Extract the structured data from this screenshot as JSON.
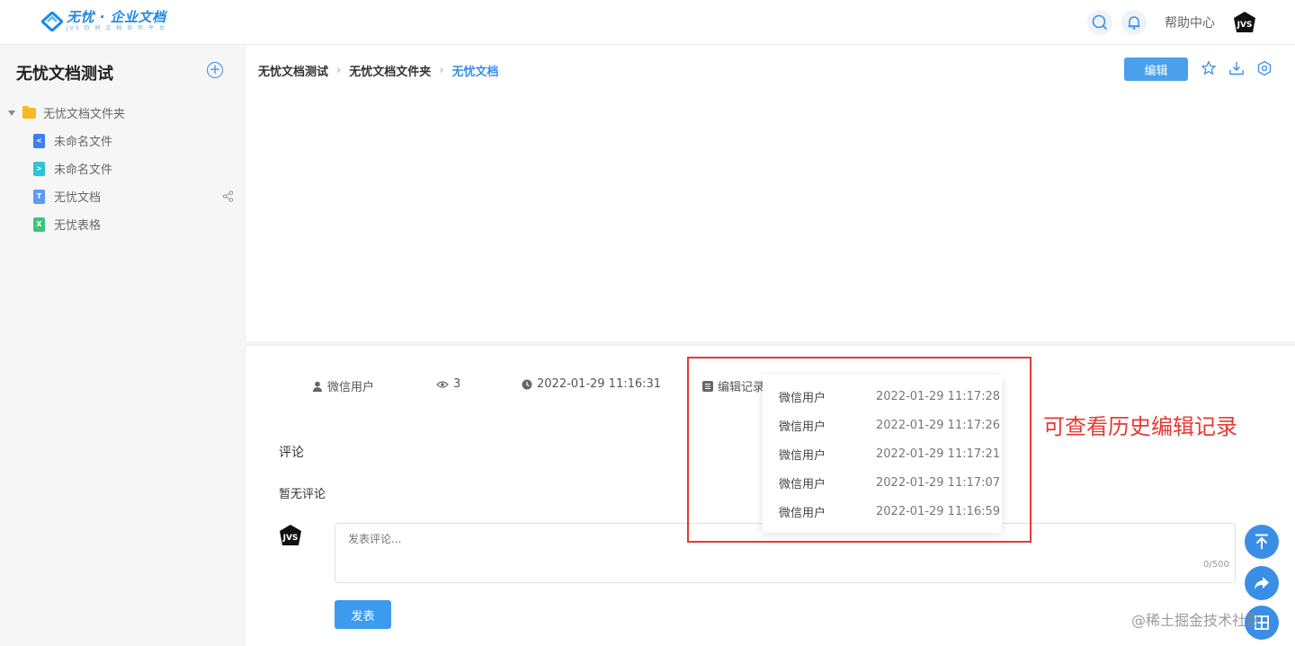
{
  "header": {
    "logo_title": "无忧 · 企业文档",
    "logo_sub": "JVS 协 同 文 档 协 作 平 台",
    "help_label": "帮助中心",
    "icons": [
      "search-icon",
      "bell-icon",
      "avatar"
    ]
  },
  "sidebar": {
    "title": "无忧文档测试",
    "folder": {
      "label": "无忧文档文件夹",
      "icon": "folder-icon"
    },
    "items": [
      {
        "label": "未命名文件",
        "icon": "mindmap-file-icon",
        "color": "#3d7ef0",
        "glyph": "<"
      },
      {
        "label": "未命名文件",
        "icon": "flow-file-icon",
        "color": "#2fc3d6",
        "glyph": ">"
      },
      {
        "label": "无忧文档",
        "icon": "doc-file-icon",
        "color": "#5b9bf0",
        "glyph": "T"
      },
      {
        "label": "无忧表格",
        "icon": "sheet-file-icon",
        "color": "#3ec47a",
        "glyph": "X"
      }
    ]
  },
  "breadcrumb": [
    "无忧文档测试",
    "无忧文档文件夹",
    "无忧文档"
  ],
  "toolbar": {
    "edit_label": "编辑",
    "icons": [
      "star-icon",
      "download-icon",
      "settings-icon"
    ]
  },
  "meta": {
    "author": "微信用户",
    "views": "3",
    "created": "2022-01-29 11:16:31",
    "history_label": "编辑记录"
  },
  "history": [
    {
      "user": "微信用户",
      "time": "2022-01-29 11:17:28"
    },
    {
      "user": "微信用户",
      "time": "2022-01-29 11:17:26"
    },
    {
      "user": "微信用户",
      "time": "2022-01-29 11:17:21"
    },
    {
      "user": "微信用户",
      "time": "2022-01-29 11:17:07"
    },
    {
      "user": "微信用户",
      "time": "2022-01-29 11:16:59"
    }
  ],
  "annotation": "可查看历史编辑记录",
  "comments": {
    "title": "评论",
    "empty": "暂无评论",
    "placeholder": "发表评论...",
    "count": "0/500",
    "publish_label": "发表"
  },
  "watermark": "@稀土掘金技术社区",
  "colors": {
    "accent": "#3a8ee6",
    "annotation": "#e53935"
  }
}
